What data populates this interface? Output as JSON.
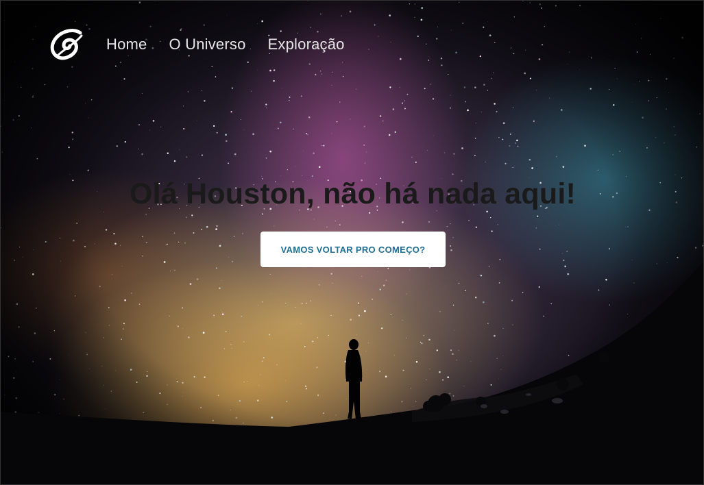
{
  "nav": {
    "logo_icon": "swirl-logo-icon",
    "links": [
      {
        "label": "Home"
      },
      {
        "label": "O Universo"
      },
      {
        "label": "Exploração"
      }
    ]
  },
  "hero": {
    "title": "Olá Houston, não há nada aqui!",
    "cta_label": "VAMOS VOLTAR PRO COMEÇO?"
  },
  "colors": {
    "title": "#1a1a1a",
    "cta_bg": "#ffffff",
    "cta_text": "#1e6f96",
    "nav_text": "#e6e6e6"
  }
}
